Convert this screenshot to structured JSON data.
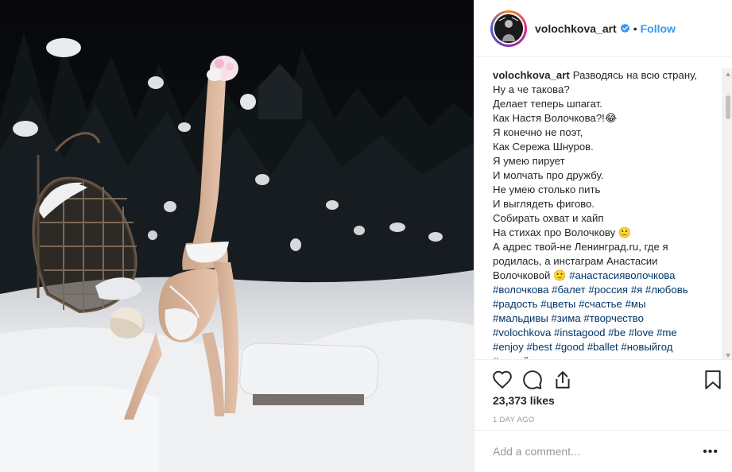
{
  "post": {
    "photo_alt": "",
    "author": "volochkova_art",
    "follow_label": "Follow",
    "separator": "•",
    "caption_lines": [
      "Разводясь на всю страну,",
      "Ну а че такова?",
      "Делает теперь шпагат.",
      "Как Настя Волочкова?!😂",
      "Я конечно не поэт,",
      "Как Сережа Шнуров.",
      "Я умею пирует",
      "И молчать про дружбу.",
      "Не умею столько пить",
      "И выглядеть фигово.",
      "Собирать охват и хайп",
      "На стихах про Волочкову 🙂",
      "А адрес твой-не Ленинград.ru, где я",
      "родилась, а инстаграм Анастасии",
      "Волочковой 🙂 #анастасияволочкова",
      "#волочкова #балет #россия #я #любовь",
      "#радость #цветы #счастье #мы",
      "#мальдивы #зима #творчество",
      "#volochkova #instagood #be #love #me",
      "#enjoy #best #good #ballet #новыйгод",
      "#новыйгод"
    ],
    "likes": "23,373 likes",
    "timestamp": "1 DAY AGO",
    "comment_placeholder": "Add a comment...",
    "more_label": "•••"
  },
  "icons": {
    "verified": "verified-badge-icon",
    "like": "heart-icon",
    "comment": "comment-bubble-icon",
    "share": "share-icon",
    "save": "bookmark-icon"
  },
  "colors": {
    "follow": "#3897f0",
    "verified": "#3897f0",
    "text": "#262626",
    "muted": "#999999",
    "hashtag": "#003569"
  }
}
